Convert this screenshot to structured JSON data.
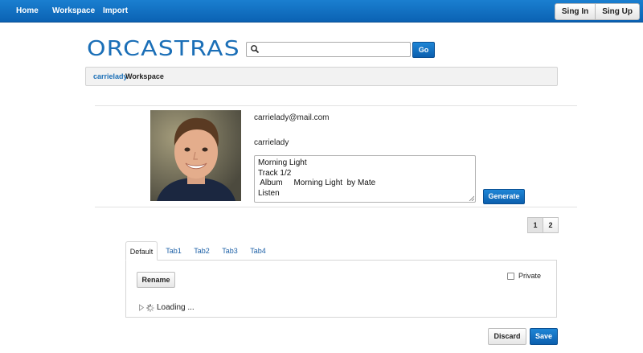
{
  "nav": {
    "home": "Home",
    "workspace": "Workspace",
    "import": "Import",
    "sign_in": "Sing In",
    "sign_up": "Sing Up"
  },
  "brand": {
    "logo_text": "ORCASTRAS"
  },
  "search": {
    "value": "",
    "placeholder": "",
    "go_label": "Go",
    "icon": "search-icon"
  },
  "workspace_bar": {
    "user": "carrielady",
    "label": "Workspace"
  },
  "profile": {
    "email": "carrielady@mail.com",
    "username": "carrielady",
    "bio_lines": [
      "Morning Light",
      "Track 1/2",
      " Album     Morning Light  by Mate",
      "Listen"
    ],
    "generate_label": "Generate"
  },
  "pagination": {
    "pages": [
      "1",
      "2"
    ],
    "current": "1"
  },
  "tabs": [
    {
      "label": "Default",
      "active": true
    },
    {
      "label": "Tab1",
      "active": false
    },
    {
      "label": "Tab2",
      "active": false
    },
    {
      "label": "Tab3",
      "active": false
    },
    {
      "label": "Tab4",
      "active": false
    }
  ],
  "panel": {
    "rename_label": "Rename",
    "private_label": "Private",
    "private_checked": false,
    "loading_text": "Loading ..."
  },
  "actions": {
    "discard_label": "Discard",
    "save_label": "Save"
  },
  "colors": {
    "nav_blue": "#0b62b3",
    "link_blue": "#1b6fb7",
    "primary_button": "#0b5fae"
  }
}
